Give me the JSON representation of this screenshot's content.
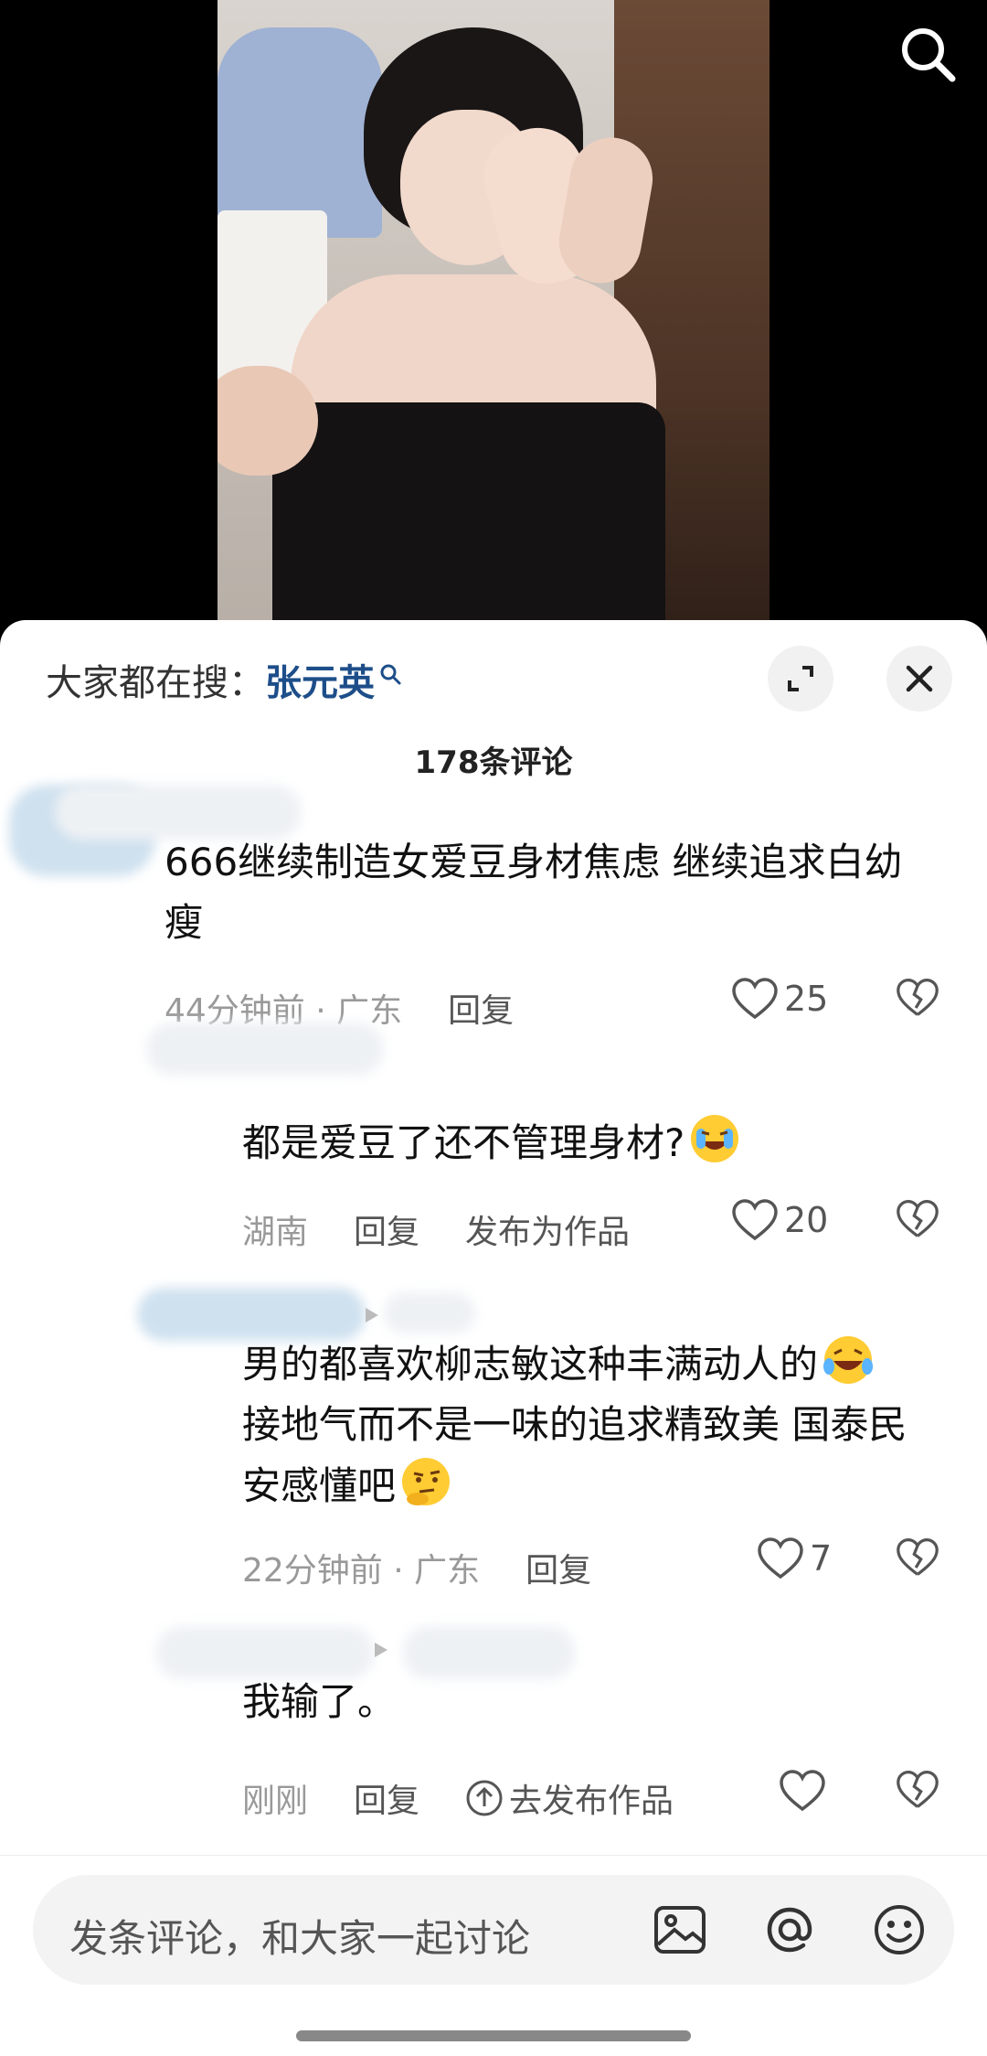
{
  "video": {
    "search_icon": "search-icon"
  },
  "sheet": {
    "hint_prefix": "大家都在搜：",
    "hint_keyword": "张元英",
    "comment_count": "178条评论"
  },
  "comments": [
    {
      "text": "666继续制造女爱豆身材焦虑 继续追求白幼瘦",
      "time": "44分钟前 · 广东",
      "reply": "回复",
      "likes": "25"
    },
    {
      "text": "都是爱豆了还不管理身材?",
      "region": "湖南",
      "reply": "回复",
      "publish": "发布为作品",
      "likes": "20"
    },
    {
      "text": "男的都喜欢柳志敏这种丰满动人的",
      "text2": "接地气而不是一味的追求精致美 国泰民安感懂吧",
      "time": "22分钟前 · 广东",
      "reply": "回复",
      "likes": "7"
    },
    {
      "text": "我输了。",
      "time": "刚刚",
      "reply": "回复",
      "publish": "去发布作品"
    }
  ],
  "input": {
    "placeholder": "发条评论，和大家一起讨论"
  }
}
